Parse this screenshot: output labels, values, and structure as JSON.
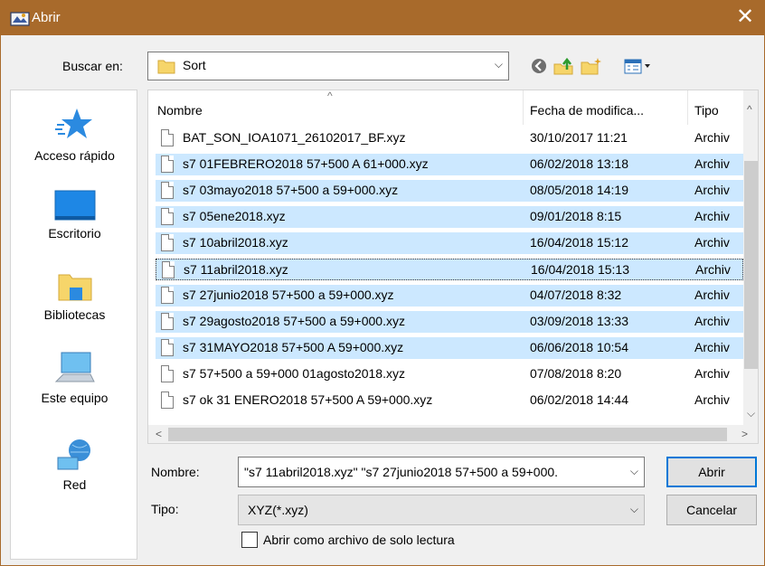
{
  "window": {
    "title": "Abrir",
    "close_glyph": "✕"
  },
  "lookin": {
    "label": "Buscar en:",
    "value": "Sort",
    "arrow": "⌵"
  },
  "places": [
    {
      "label": "Acceso rápido",
      "icon": "star-icon"
    },
    {
      "label": "Escritorio",
      "icon": "desktop-icon"
    },
    {
      "label": "Bibliotecas",
      "icon": "libraries-icon"
    },
    {
      "label": "Este equipo",
      "icon": "computer-icon"
    },
    {
      "label": "Red",
      "icon": "network-icon"
    }
  ],
  "columns": {
    "name": "Nombre",
    "date": "Fecha de modifica...",
    "type": "Tipo",
    "sort_glyph": "^"
  },
  "files": [
    {
      "name": "BAT_SON_IOA1071_26102017_BF.xyz",
      "date": "30/10/2017 11:21",
      "type": "Archiv"
    },
    {
      "name": "s7 01FEBRERO2018 57+500 A 61+000.xyz",
      "date": "06/02/2018 13:18",
      "type": "Archiv"
    },
    {
      "name": "s7 03mayo2018 57+500 a 59+000.xyz",
      "date": "08/05/2018 14:19",
      "type": "Archiv"
    },
    {
      "name": "s7 05ene2018.xyz",
      "date": "09/01/2018 8:15",
      "type": "Archiv"
    },
    {
      "name": "s7 10abril2018.xyz",
      "date": "16/04/2018 15:12",
      "type": "Archiv"
    },
    {
      "name": "s7 11abril2018.xyz",
      "date": "16/04/2018 15:13",
      "type": "Archiv"
    },
    {
      "name": "s7 27junio2018 57+500 a 59+000.xyz",
      "date": "04/07/2018 8:32",
      "type": "Archiv"
    },
    {
      "name": "s7 29agosto2018 57+500 a 59+000.xyz",
      "date": "03/09/2018 13:33",
      "type": "Archiv"
    },
    {
      "name": "s7 31MAYO2018 57+500 A 59+000.xyz",
      "date": "06/06/2018 10:54",
      "type": "Archiv"
    },
    {
      "name": "s7 57+500 a 59+000 01agosto2018.xyz",
      "date": "07/08/2018 8:20",
      "type": "Archiv"
    },
    {
      "name": "s7 ok 31 ENERO2018 57+500 A 59+000.xyz",
      "date": "06/02/2018 14:44",
      "type": "Archiv"
    }
  ],
  "scroll": {
    "up": "^",
    "down": "⌵",
    "left": "<",
    "right": ">"
  },
  "filename": {
    "label": "Nombre:",
    "value": "\"s7 11abril2018.xyz\" \"s7 27junio2018 57+500 a 59+000.",
    "arrow": "⌵"
  },
  "filetype": {
    "label": "Tipo:",
    "value": "XYZ(*.xyz)",
    "arrow": "⌵"
  },
  "buttons": {
    "open": "Abrir",
    "cancel": "Cancelar"
  },
  "readonly": {
    "label": "Abrir como archivo de solo lectura",
    "checked": false
  },
  "colors": {
    "titlebar": "#a86a2b",
    "selection": "#cce8ff",
    "default_button_border": "#0078d7"
  }
}
